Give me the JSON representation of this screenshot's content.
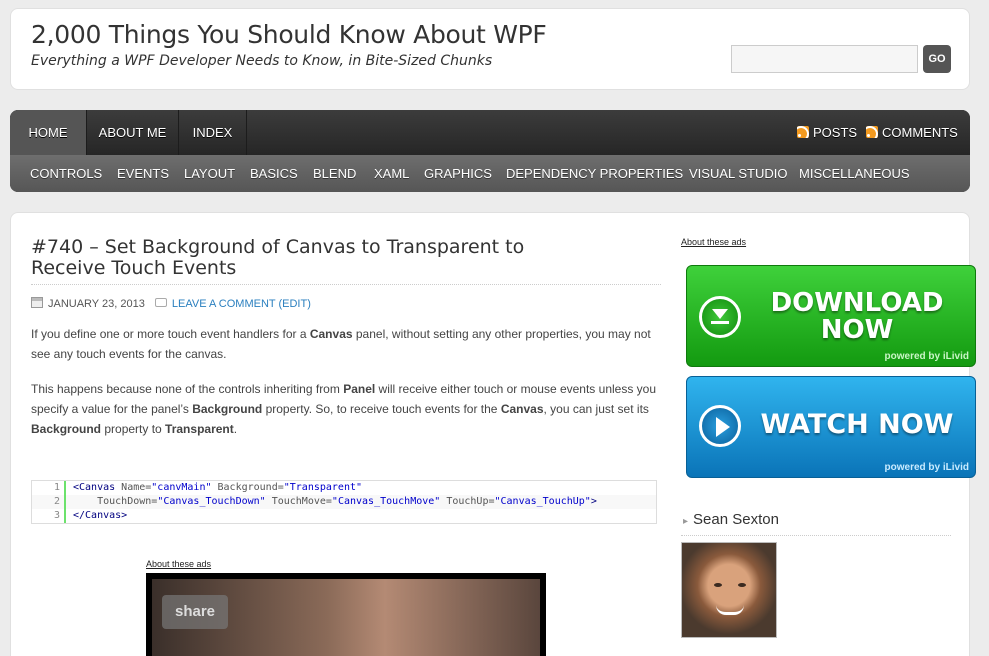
{
  "header": {
    "title": "2,000 Things You Should Know About WPF",
    "description": "Everything a WPF Developer Needs to Know, in Bite-Sized Chunks",
    "search_placeholder": "",
    "search_button": "GO"
  },
  "nav": {
    "primary": [
      {
        "label": "HOME",
        "active": true
      },
      {
        "label": "ABOUT ME",
        "active": false
      },
      {
        "label": "INDEX",
        "active": false
      }
    ],
    "feeds": [
      "POSTS",
      "COMMENTS"
    ],
    "categories": [
      "CONTROLS",
      "EVENTS",
      "LAYOUT",
      "BASICS",
      "BLEND",
      "XAML",
      "GRAPHICS",
      "DEPENDENCY PROPERTIES",
      "VISUAL STUDIO",
      "MISCELLANEOUS"
    ]
  },
  "post": {
    "title": "#740 – Set Background of Canvas to Transparent to Receive Touch Events",
    "date": "JANUARY 23, 2013",
    "comment_link": "LEAVE A COMMENT",
    "edit_link": "(EDIT)",
    "para1": {
      "a": "If you define one or more touch event handlers for a ",
      "b": "Canvas",
      "c": " panel, without setting any other properties, you may not see any touch events for the canvas."
    },
    "para2": {
      "a": "This happens because none of the controls inheriting from ",
      "b": "Panel",
      "c": " will receive either touch or mouse events unless you specify a value for the panel’s ",
      "d": "Background",
      "e": " property.  So, to receive touch events for the ",
      "f": "Canvas",
      "g": ", you can just set its ",
      "h": "Background",
      "i": " property to ",
      "j": "Transparent",
      "k": "."
    },
    "code": {
      "line_numbers": [
        "1",
        "2",
        "3"
      ],
      "l1": {
        "open": "<Canvas",
        "a1": " Name=",
        "v1": "\"canvMain\"",
        "a2": " Background=",
        "v2": "\"Transparent\""
      },
      "l2": {
        "indent": "    ",
        "a1": "TouchDown=",
        "v1": "\"Canvas_TouchDown\"",
        "a2": " TouchMove=",
        "v2": "\"Canvas_TouchMove\"",
        "a3": " TouchUp=",
        "v3": "\"Canvas_TouchUp\"",
        "close": ">"
      },
      "l3": {
        "close": "</Canvas>"
      }
    },
    "ads_label": "About these ads",
    "video_share": "share"
  },
  "sidebar": {
    "ads_label": "About these ads",
    "ad_download": {
      "text": "DOWNLOAD NOW",
      "powered": "powered by iLivid"
    },
    "ad_watch": {
      "text": "WATCH NOW",
      "powered": "powered by iLivid"
    },
    "author_name": "Sean Sexton",
    "bullet": "▸"
  },
  "colors": {
    "link": "#2a7fbf",
    "nav_dark": "#2e2e2e",
    "nav_light": "#5e5e5e",
    "rss": "#f39a1f",
    "ad_green": "#22b41e",
    "ad_blue": "#1a8fd4"
  }
}
